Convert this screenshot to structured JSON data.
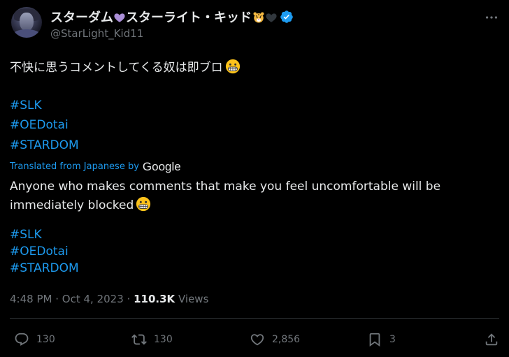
{
  "author": {
    "display_name": "スターダム💜スターライト・キッド🐯🖤",
    "display_name_text_1": "スターダム",
    "display_name_text_2": "スターライト・キッド",
    "handle": "@StarLight_Kid11",
    "verified": true
  },
  "tweet": {
    "original_text": "不快に思うコメントしてくる奴は即ブロ",
    "hashtags_original": [
      "#SLK",
      "#OEDotai",
      "#STARDOM"
    ],
    "translated_label": "Translated from Japanese by",
    "translator": "Google",
    "translated_line_1": "Anyone who makes comments that make you feel uncomfortable will be",
    "translated_line_2": "immediately blocked",
    "hashtags_translated": [
      "#SLK",
      "#OEDotai",
      "#STARDOM"
    ]
  },
  "meta": {
    "time": "4:48 PM",
    "separator": "·",
    "date": "Oct 4, 2023",
    "views_count": "110.3K",
    "views_label": "Views"
  },
  "actions": {
    "replies": "130",
    "reposts": "130",
    "likes": "2,856",
    "bookmarks": "3"
  },
  "icons": {
    "reply": "reply-icon",
    "repost": "repost-icon",
    "like": "heart-icon",
    "bookmark": "bookmark-icon",
    "share": "share-icon",
    "more": "more-icon",
    "verified": "verified-badge-icon"
  },
  "colors": {
    "background": "#000000",
    "text": "#e7e9ea",
    "muted": "#71767b",
    "link": "#1d9bf0",
    "verified": "#1d9bf0"
  }
}
